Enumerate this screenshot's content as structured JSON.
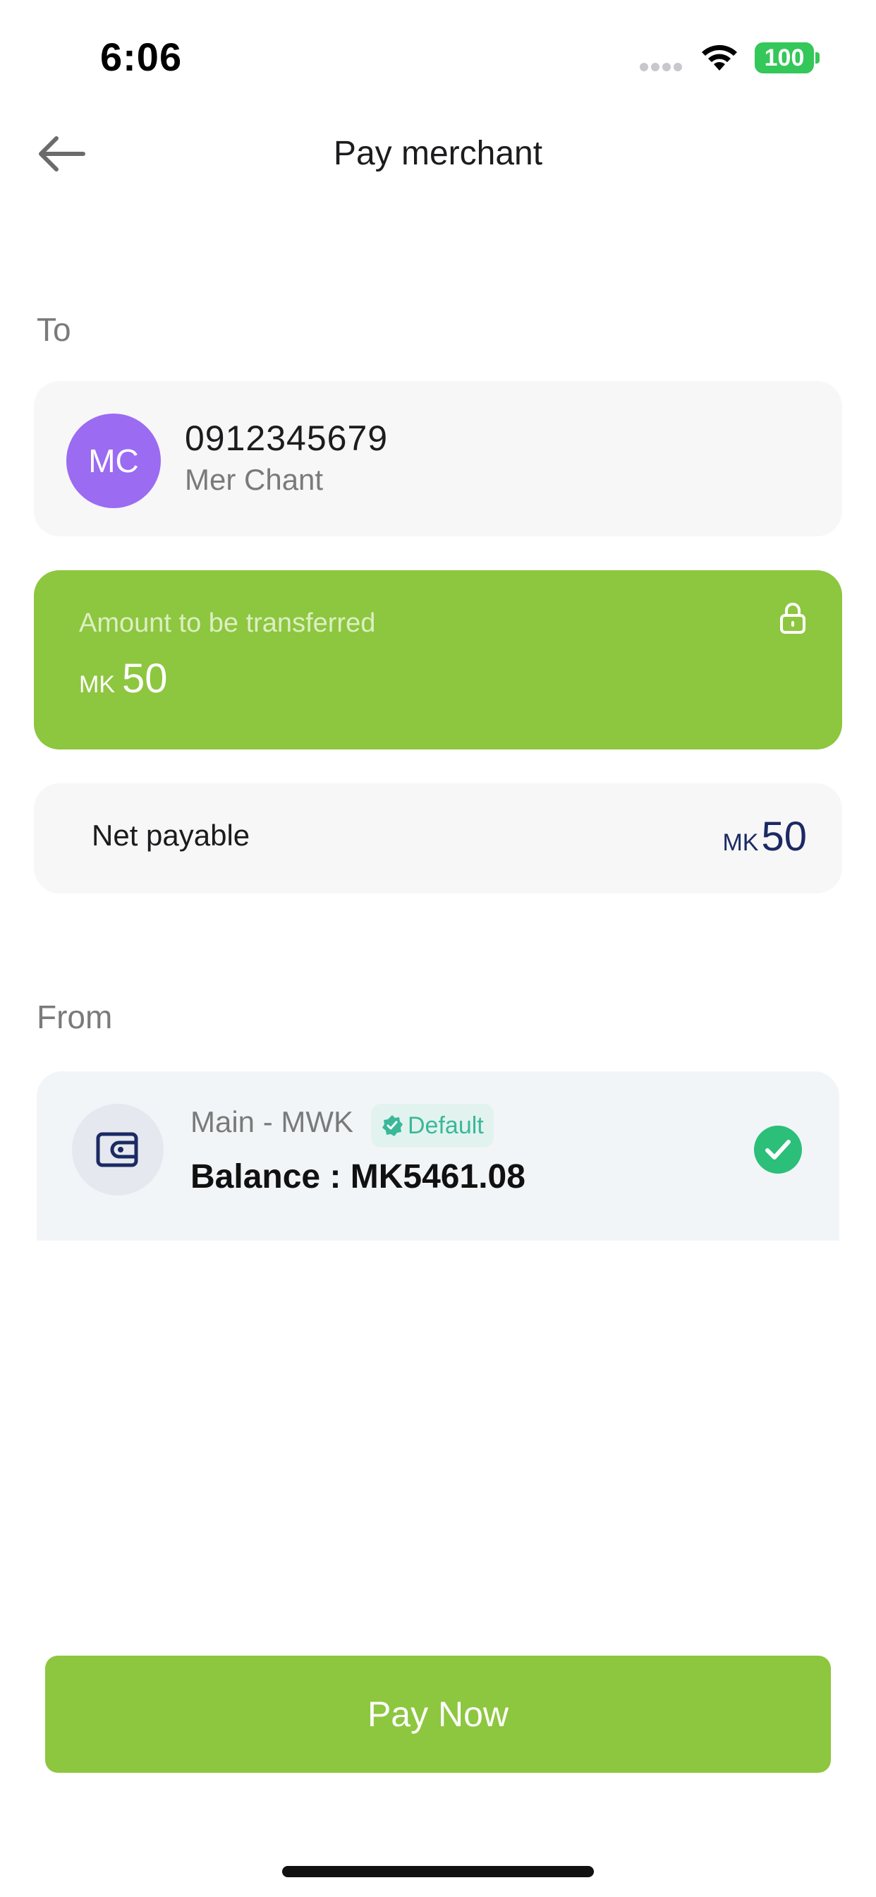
{
  "status_bar": {
    "time": "6:06",
    "battery": "100"
  },
  "header": {
    "title": "Pay merchant",
    "back_icon": "arrow-left-icon"
  },
  "to_section": {
    "label": "To",
    "recipient": {
      "initials": "MC",
      "phone": "0912345679",
      "name": "Mer Chant",
      "avatar_color": "#9b6bf2"
    }
  },
  "amount": {
    "label": "Amount to be transferred",
    "currency": "MK",
    "value": "50",
    "icon": "lock-icon"
  },
  "net_payable": {
    "label": "Net payable",
    "currency": "MK",
    "value": "50"
  },
  "from_section": {
    "label": "From",
    "account": {
      "name": "Main - MWK",
      "badge": "Default",
      "balance": "Balance : MK5461.08",
      "icon": "wallet-icon",
      "selected": true
    }
  },
  "actions": {
    "pay_label": "Pay Now"
  },
  "colors": {
    "accent_green": "#8dc63f",
    "navy": "#1b2a63",
    "check_green": "#2bbf7a",
    "badge_teal": "#3bb89a"
  }
}
